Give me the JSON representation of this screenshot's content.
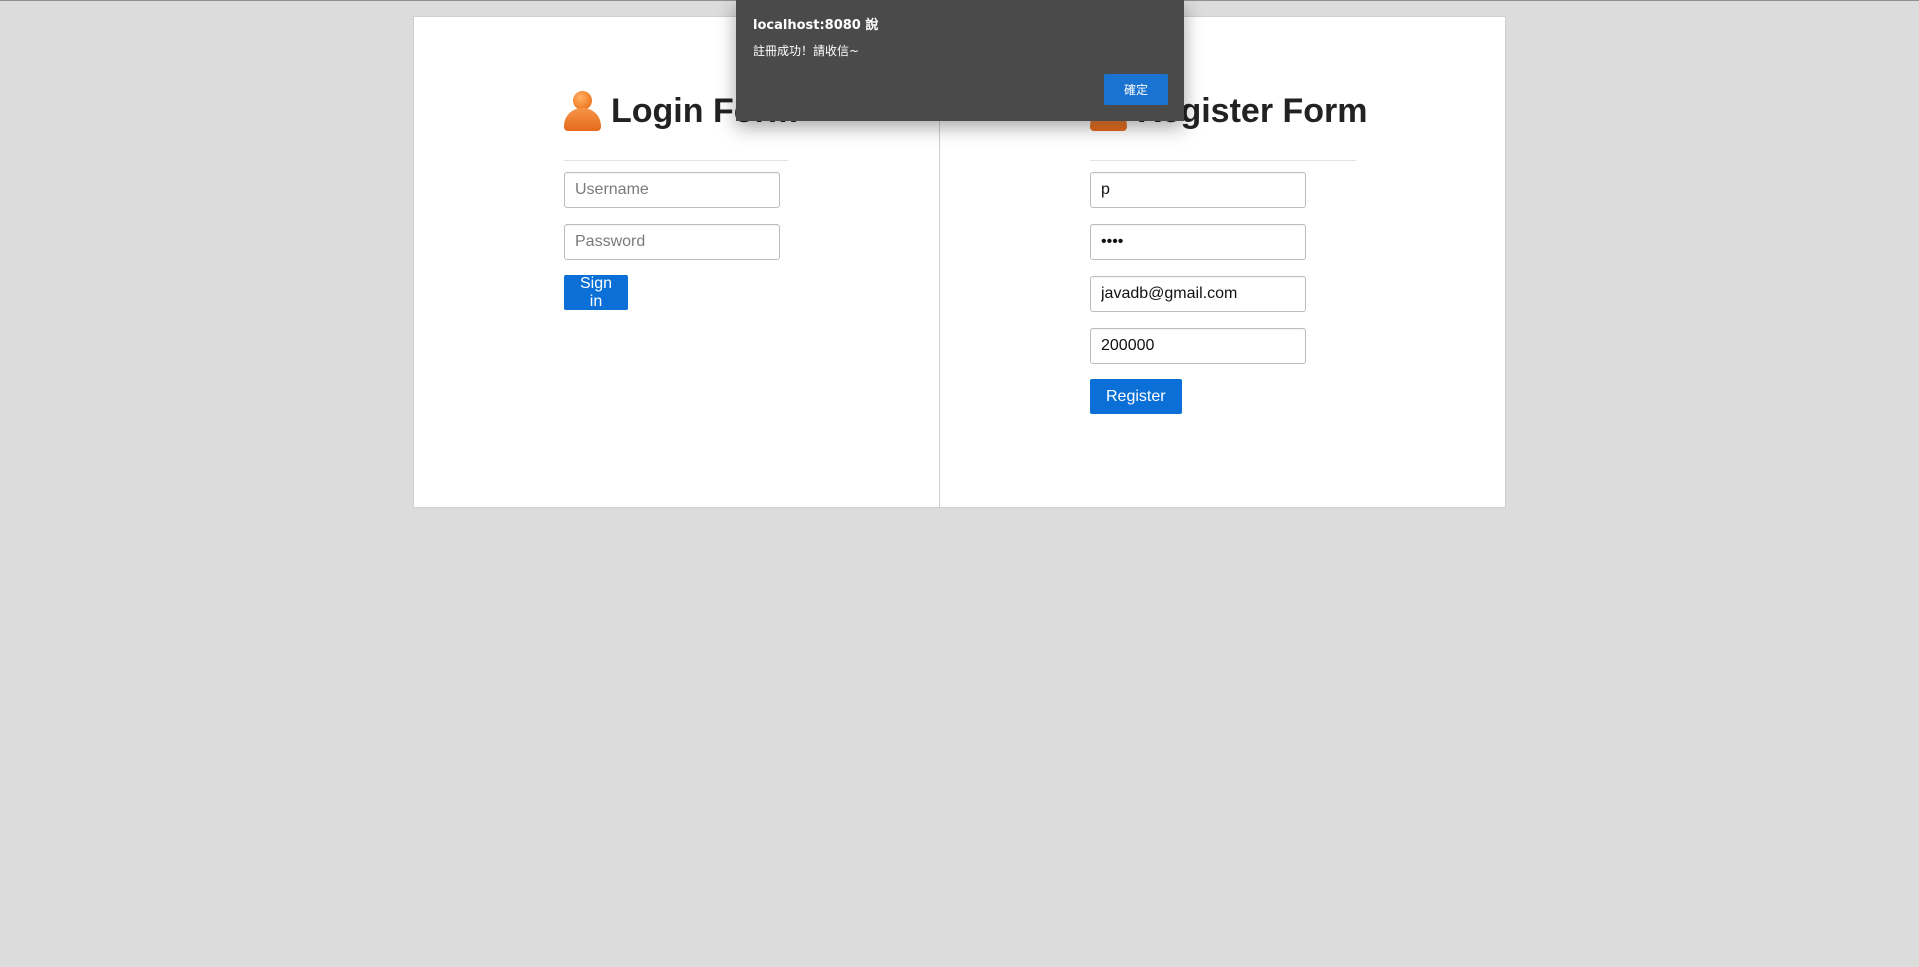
{
  "dialog": {
    "title": "localhost:8080 說",
    "message": "註冊成功！請收信~",
    "ok_label": "確定"
  },
  "login": {
    "title": "Login Form",
    "icon": "person-icon",
    "username_placeholder": "Username",
    "password_placeholder": "Password",
    "submit_label": "Sign in"
  },
  "register": {
    "title": "Register Form",
    "icon": "person-icon",
    "username_value": "p",
    "password_value": "1234",
    "email_value": "javadb@gmail.com",
    "number_value": "200000",
    "submit_label": "Register"
  },
  "colors": {
    "page_background": "#dcdcdc",
    "primary_button": "#0a6fd6",
    "dialog_background": "#4a4a4a",
    "icon_orange": "#f07a22"
  }
}
